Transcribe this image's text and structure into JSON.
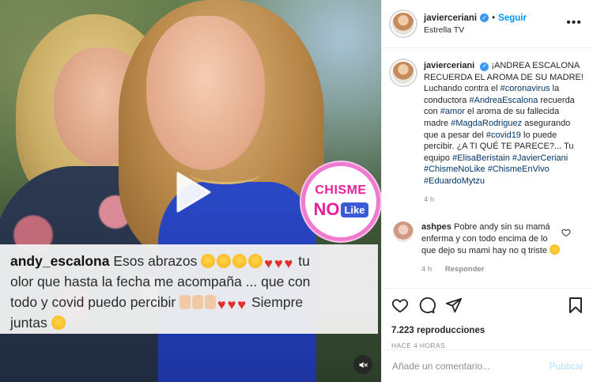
{
  "media": {
    "logo_top": "CHISME",
    "logo_no": "NO",
    "logo_like": "Like",
    "caption": {
      "user": "andy_escalona",
      "line1": "Esos abrazos",
      "line1b": "tu",
      "line2": "olor que hasta la fecha me acompaña ... que con",
      "line3": "todo y covid puedo percibir",
      "line3b": "Siempre",
      "line4": "juntas"
    }
  },
  "header": {
    "username": "javierceriani",
    "follow_label": "Seguir",
    "location": "Estrella TV"
  },
  "post": {
    "username": "javierceriani",
    "parts": [
      {
        "t": "¡ANDREA ESCALONA RECUERDA EL AROMA DE SU MADRE! Luchando contra el "
      },
      {
        "tag": "#coronavirus"
      },
      {
        "t": " la conductora "
      },
      {
        "tag": "#AndreaEscalona"
      },
      {
        "t": " recuerda con "
      },
      {
        "tag": "#amor"
      },
      {
        "t": " el aroma de su fallecida madre "
      },
      {
        "tag": "#MagdaRodriguez"
      },
      {
        "t": " asegurando que a pesar del "
      },
      {
        "tag": "#covid19"
      },
      {
        "t": " lo puede percibir. ¿A TI QUÉ TE PARECE?... Tu equipo "
      },
      {
        "tag": "#ElisaBeristain"
      },
      {
        "t": " "
      },
      {
        "tag": "#JavierCeriani"
      },
      {
        "t": " "
      },
      {
        "tag": "#ChismeNoLike"
      },
      {
        "t": " "
      },
      {
        "tag": "#ChismeEnVivo"
      },
      {
        "t": " "
      },
      {
        "tag": "#EduardoMytzu"
      }
    ],
    "time": "4 h"
  },
  "comment": {
    "username": "ashpes",
    "text": "Pobre andy sin su mamá enferma y con todo encima de lo que dejo su mami hay no q triste",
    "time": "4 h",
    "reply_label": "Responder"
  },
  "stats": {
    "views": "7.223 reproducciones",
    "posted": "HACE 4 HORAS"
  },
  "add_comment": {
    "placeholder": "Añade un comentario...",
    "publish_label": "Publicar"
  },
  "colors": {
    "link": "#0095f6",
    "hashtag": "#00376b",
    "muted": "#8e8e8e",
    "publish_disabled": "#b2dffc"
  },
  "icons": [
    "play-icon",
    "mute-icon",
    "more-icon",
    "verified-icon",
    "heart-icon",
    "comment-icon",
    "share-icon",
    "bookmark-icon"
  ]
}
